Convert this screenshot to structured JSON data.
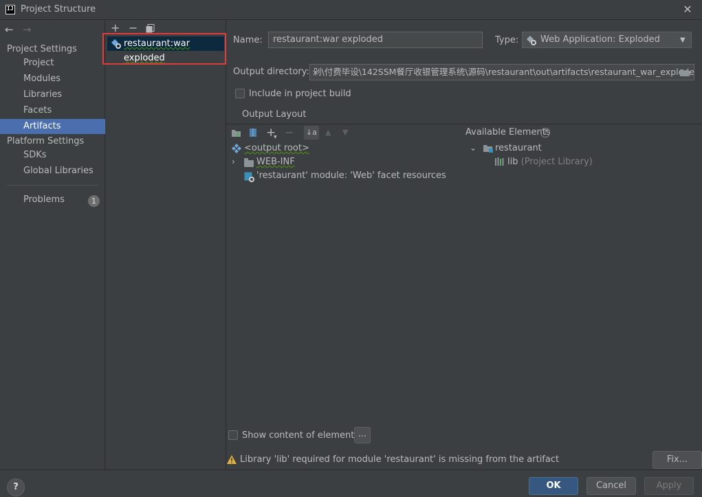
{
  "window": {
    "title": "Project Structure",
    "app_icon": "IJ"
  },
  "nav": {
    "project_settings_heading": "Project Settings",
    "items_project": [
      "Project",
      "Modules",
      "Libraries",
      "Facets",
      "Artifacts"
    ],
    "platform_settings_heading": "Platform Settings",
    "items_platform": [
      "SDKs",
      "Global Libraries"
    ],
    "problems_label": "Problems",
    "problems_count": "1"
  },
  "artifacts": {
    "toolbar_add": "+",
    "toolbar_remove": "−",
    "selected_artifact": "restaurant:war exploded"
  },
  "config": {
    "name_label": "Name:",
    "name_value": "restaurant:war exploded",
    "type_label": "Type:",
    "type_value": "Web Application: Exploded",
    "output_dir_label": "Output directory:",
    "output_dir_value": "剁\\付费毕设\\142SSM餐厅收银管理系统\\源码\\restaurant\\out\\artifacts\\restaurant_war_exploded",
    "include_in_build_label": "Include in project build",
    "output_layout_label": "Output Layout"
  },
  "layout": {
    "tree_items": [
      "<output root>",
      "WEB-INF",
      "'restaurant' module: 'Web' facet resources"
    ],
    "available_elements_label": "Available Elements",
    "available_root": "restaurant",
    "available_lib": "lib",
    "available_lib_hint": "(Project Library)"
  },
  "footer": {
    "show_content_label": "Show content of elements",
    "ellipsis_button": "...",
    "warning_text": "Library 'lib' required for module 'restaurant' is missing from the artifact",
    "fix_button": "Fix...",
    "ok_button": "OK",
    "cancel_button": "Cancel",
    "apply_button": "Apply",
    "help_button": "?"
  },
  "colors": {
    "selection": "#4b6eaf",
    "highlight_border": "#e03c3c",
    "warning": "#e0b040"
  }
}
